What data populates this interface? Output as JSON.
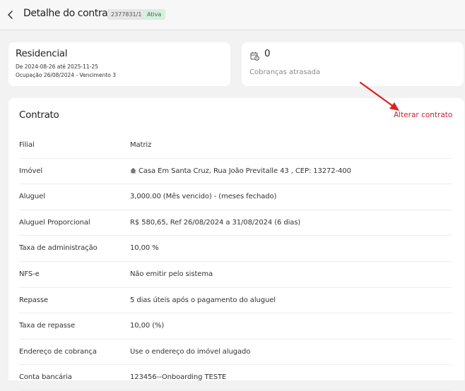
{
  "header": {
    "title": "Detalhe do contrato",
    "contract_id": "2377831/1",
    "status": "Ativa",
    "status_color": "#3a6b4f"
  },
  "property_card": {
    "title": "Residencial",
    "period": "De 2024-08-26 até 2025-11-25",
    "occupation": "Ocupação 26/08/2024 - Vencimento 3"
  },
  "overdue_card": {
    "icon": "calendar-clock-icon",
    "count": "0",
    "label": "Cobranças atrasada"
  },
  "contract": {
    "heading": "Contrato",
    "alter_label": "Alterar contrato",
    "accent_color": "#c8233a",
    "rows": [
      {
        "label": "Filial",
        "value": "Matriz"
      },
      {
        "label": "Imóvel",
        "value": "Casa Em Santa Cruz, Rua João Previtalle 43 , CEP: 13272-400",
        "icon": "home-icon"
      },
      {
        "label": "Aluguel",
        "value": "3,000.00 (Mês vencido) - (meses fechado)"
      },
      {
        "label": "Aluguel Proporcional",
        "value": "R$ 580,65, Ref 26/08/2024 a 31/08/2024 (6 dias)"
      },
      {
        "label": "Taxa de administração",
        "value": "10,00 %"
      },
      {
        "label": "NFS-e",
        "value": "Não emitir pelo sistema"
      },
      {
        "label": "Repasse",
        "value": "5 dias úteis após o pagamento do aluguel"
      },
      {
        "label": "Taxa de repasse",
        "value": "10,00 (%)"
      },
      {
        "label": "Endereço de cobrança",
        "value": "Use o endereço do imóvel alugado"
      },
      {
        "label": "Conta bancária",
        "value": "123456--Onboarding TESTE"
      }
    ]
  }
}
